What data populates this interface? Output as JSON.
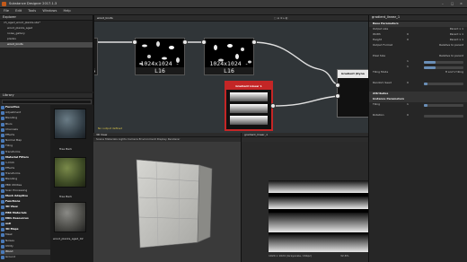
{
  "window": {
    "title": "Substance Designer 2017.1.3"
  },
  "menu": [
    "File",
    "Edit",
    "Tools",
    "Windows",
    "Help"
  ],
  "explorer": {
    "title": "Explorer",
    "rows": [
      {
        "label": "ch_aged_wood_planks.sbs*"
      },
      {
        "label": "wood_planks_aged"
      },
      {
        "label": "noise_gallery"
      },
      {
        "label": "planks"
      },
      {
        "label": "wood_knots",
        "selected": true
      }
    ]
  },
  "library": {
    "title": "Library",
    "categories": [
      {
        "label": "Favorites",
        "header": true
      },
      {
        "label": "Adjustment"
      },
      {
        "label": "Blending"
      },
      {
        "label": "Blurs"
      },
      {
        "label": "Channels"
      },
      {
        "label": "Effects"
      },
      {
        "label": "Normal Map"
      },
      {
        "label": "Tiling"
      },
      {
        "label": "Transforms"
      },
      {
        "label": "Material Filters",
        "header": true
      },
      {
        "label": "1-Click"
      },
      {
        "label": "Effects"
      },
      {
        "label": "Transforms"
      },
      {
        "label": "Blending"
      },
      {
        "label": "PBR Utilities"
      },
      {
        "label": "Scan Processing"
      },
      {
        "label": "Mesh Adaptive",
        "header": true
      },
      {
        "label": "Functions",
        "header": true
      },
      {
        "label": "3D View",
        "header": true
      },
      {
        "label": "PBR Materials",
        "header": true
      },
      {
        "label": "MDL Resources",
        "header": true
      },
      {
        "label": "mdl",
        "header": true
      },
      {
        "label": "3D Maps",
        "header": true
      },
      {
        "label": "Mask"
      },
      {
        "label": "Noises"
      },
      {
        "label": "Utility"
      },
      {
        "label": "Wood",
        "selected": true
      },
      {
        "label": "Ground"
      }
    ],
    "thumbs": [
      {
        "label": "Tree Bark"
      },
      {
        "label": "Tree Bark"
      },
      {
        "label": "wood_planks_aged_02"
      }
    ]
  },
  "graph": {
    "title": "wood_knots",
    "nodes": [
      {
        "label": "1024x1024 - L16"
      },
      {
        "label": "1024x1024 - L16"
      }
    ],
    "gradient_node": {
      "title": "Gradient Linear 1"
    },
    "output_node": {
      "title": "Gradient (Dyna"
    },
    "left_label": "16",
    "status": "No output defined"
  },
  "view3d": {
    "title": "3D View",
    "menu": [
      "Scene",
      "Materials",
      "Lights",
      "Camera",
      "Environment",
      "Display",
      "Renderer"
    ]
  },
  "view2d": {
    "title": "gradient_linear_1",
    "status": "1024 x 1024 (Grayscale, 16bpc)",
    "zoom": "32.6%"
  },
  "properties": {
    "title": "gradient_linear_1",
    "rows": [
      {
        "label": "Base Parameters",
        "section": true
      },
      {
        "label": "Output size",
        "value": "",
        "right": "Parent x 1"
      },
      {
        "label": "Width",
        "value": "0",
        "right": "Parent x 1"
      },
      {
        "label": "Height",
        "value": "0",
        "right": "Parent x 1"
      },
      {
        "label": "Output Format",
        "value": "",
        "right": "Relative to parent"
      },
      {
        "label": "",
        "value": ""
      },
      {
        "label": "Pixel Size",
        "value": "",
        "right": "Relative to parent"
      },
      {
        "label": "",
        "value": "1",
        "slider": 0.3
      },
      {
        "label": "",
        "value": "1",
        "slider": 0.3
      },
      {
        "label": "Tiling Mode",
        "value": "",
        "right": "H and V tiling"
      },
      {
        "label": "",
        "value": ""
      },
      {
        "label": "Random Seed",
        "value": "0",
        "slider": 0.1
      },
      {
        "label": "",
        "value": ""
      },
      {
        "label": "Attributes",
        "section": true
      },
      {
        "label": "Instance Parameters",
        "section": true
      },
      {
        "label": "Tiling",
        "value": "1",
        "slider": 0.1
      },
      {
        "label": "",
        "value": ""
      },
      {
        "label": "Rotation",
        "value": "0",
        "slider": 0.0
      },
      {
        "label": "",
        "value": ""
      }
    ]
  },
  "colors": {
    "gradient_header": "#c42626",
    "connection": "#e0e0e0",
    "slider_fill": "#6a8fb8"
  }
}
